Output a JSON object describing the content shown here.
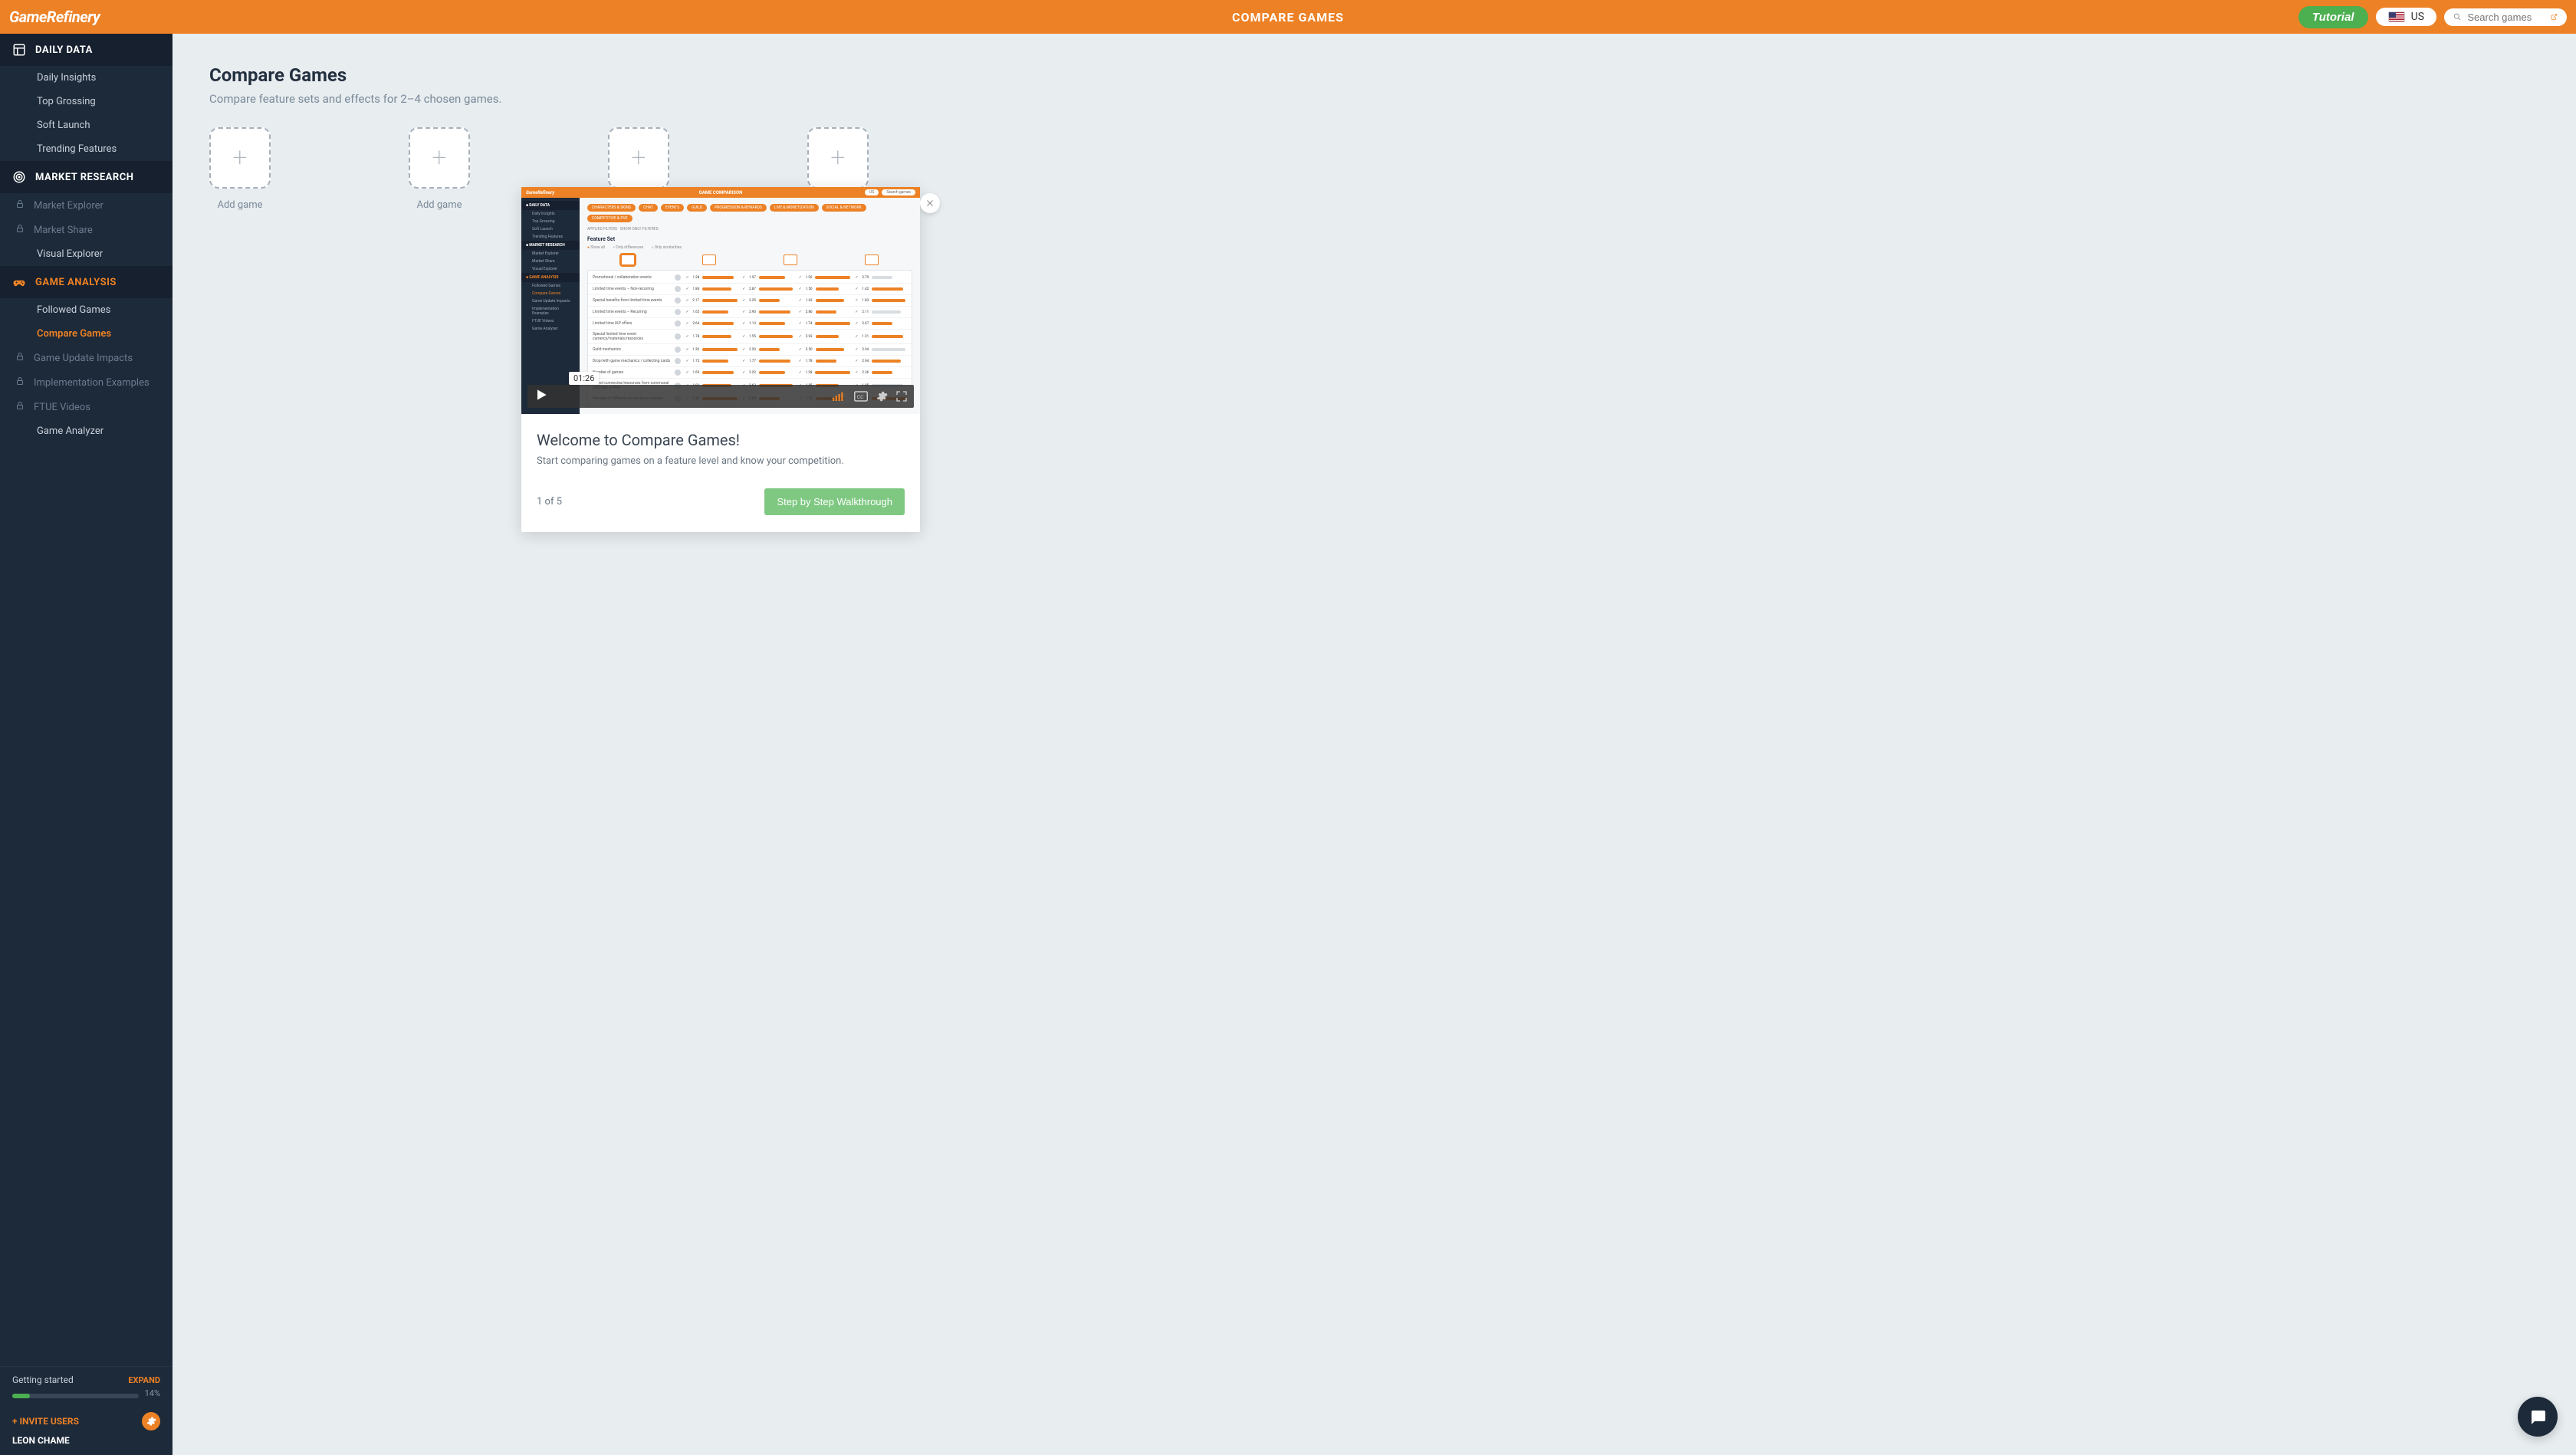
{
  "header": {
    "brand": "GameRefinery",
    "title": "COMPARE GAMES",
    "tutorial_label": "Tutorial",
    "region_label": "US",
    "search_placeholder": "Search games"
  },
  "sidebar": {
    "sections": [
      {
        "key": "daily",
        "label": "DAILY DATA",
        "active_section": false,
        "items": [
          {
            "label": "Daily Insights",
            "locked": false,
            "active": false
          },
          {
            "label": "Top Grossing",
            "locked": false,
            "active": false
          },
          {
            "label": "Soft Launch",
            "locked": false,
            "active": false
          },
          {
            "label": "Trending Features",
            "locked": false,
            "active": false
          }
        ]
      },
      {
        "key": "market",
        "label": "MARKET RESEARCH",
        "active_section": false,
        "items": [
          {
            "label": "Market Explorer",
            "locked": true,
            "active": false
          },
          {
            "label": "Market Share",
            "locked": true,
            "active": false
          },
          {
            "label": "Visual Explorer",
            "locked": false,
            "active": false
          }
        ]
      },
      {
        "key": "analysis",
        "label": "GAME ANALYSIS",
        "active_section": true,
        "items": [
          {
            "label": "Followed Games",
            "locked": false,
            "active": false
          },
          {
            "label": "Compare Games",
            "locked": false,
            "active": true
          },
          {
            "label": "Game Update Impacts",
            "locked": true,
            "active": false
          },
          {
            "label": "Implementation Examples",
            "locked": true,
            "active": false
          },
          {
            "label": "FTUE Videos",
            "locked": true,
            "active": false
          },
          {
            "label": "Game Analyzer",
            "locked": false,
            "active": false
          }
        ]
      }
    ],
    "getting_started": {
      "label": "Getting started",
      "expand": "EXPAND",
      "percent_label": "14%",
      "percent_value": 14
    },
    "invite_label": "+ INVITE USERS",
    "user_name": "LEON CHAME"
  },
  "main": {
    "title": "Compare Games",
    "subtitle": "Compare feature sets and effects for 2–4 chosen games.",
    "add_label": "Add game",
    "slot_count": 4
  },
  "modal": {
    "title": "Welcome to Compare Games!",
    "description": "Start comparing games on a feature level and know your competition.",
    "step_label": "1 of 5",
    "cta_label": "Step by Step Walkthrough",
    "video_duration": "01:26",
    "video_mock": {
      "header_title": "GAME COMPARISON",
      "region": "US",
      "search": "Search games",
      "pills": [
        "CHARACTERS & SKINS",
        "CHAT",
        "EVENTS",
        "GUILD",
        "PROGRESSION & REWARDS",
        "LIVE & MONETIZATION",
        "SOCIAL & NETWORK",
        "COMPETITIVE & PVE"
      ],
      "section_title": "Feature Set",
      "radios": [
        "Show all",
        "Only differences",
        "Only similarities"
      ],
      "rows": [
        "Promotional / collaboration events",
        "Limited time events – Non-recurring",
        "Special benefits from limited time events",
        "Limited time events – Recurring",
        "Limited time IAP offers",
        "Special limited time event currency/materials/resources",
        "Guild mechanics",
        "Drop/with game mechanics / collecting cards",
        "Number of games",
        "Spend currencies/resources from communal activities or PvP",
        "Number of different currencies to acquire"
      ]
    }
  },
  "colors": {
    "accent": "#ed8125",
    "sidebar_bg": "#1d2a3a",
    "sidebar_header_bg": "#16202e",
    "success": "#4caf50",
    "body_bg": "#e8edf0"
  }
}
